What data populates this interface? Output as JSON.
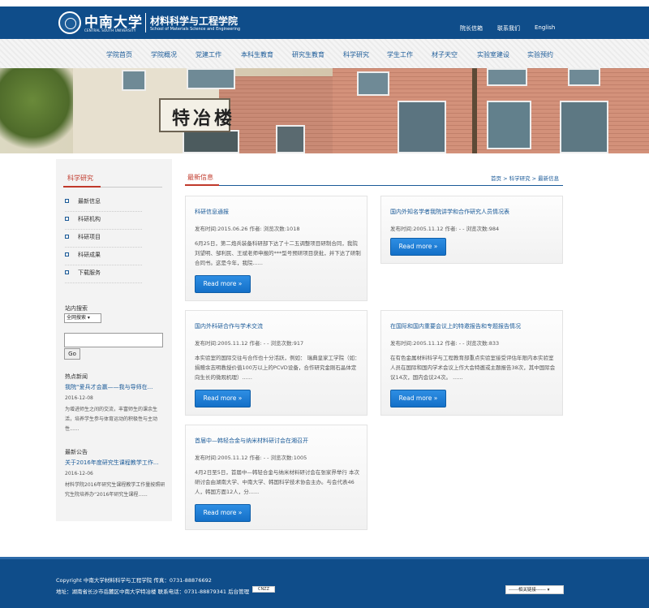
{
  "header": {
    "logo_cn": "中南大学",
    "logo_en": "CENTRAL SOUTH UNIVERSITY",
    "college_cn": "材料科学与工程学院",
    "college_en": "School of Materials Science and Engineering",
    "links": [
      "院长信箱",
      "联系我们",
      "English"
    ]
  },
  "nav": [
    "学院首页",
    "学院概况",
    "党建工作",
    "本科生教育",
    "研究生教育",
    "科学研究",
    "学生工作",
    "材子天空",
    "实验室建设",
    "实验预约"
  ],
  "banner": {
    "sign_text": "特冶楼"
  },
  "sidebar": {
    "title": "科学研究",
    "items": [
      "最新信息",
      "科研机构",
      "科研项目",
      "科研成果",
      "下载服务"
    ],
    "search_label": "站内搜索",
    "search_scope": "全网搜索",
    "go_label": "Go",
    "hot_title": "热点新闻",
    "hot_link": "我院“爱兵才会赢——我与导师在...",
    "hot_date": "2016-12-08",
    "hot_desc": "为增进师生之间的交流，丰富师生的课余生活，培养学生参与体育运动的积极性与主动性......",
    "notice_title": "最新公告",
    "notice_link": "关于2016年度研究生课程教学工作...",
    "notice_date": "2016-12-06",
    "notice_desc": "材料学院2016年研究生课程教学工作量按照研究生院培养办“2016年研究生课程......"
  },
  "main": {
    "title": "最新信息",
    "breadcrumb": "首页 > 科学研究 > 最新信息",
    "more_label": "Read more »",
    "cards": [
      {
        "title": "科研信息通报",
        "meta": "发布时间:2015.06.26     作者:        浏览次数:1018",
        "desc": "6月25日，第二炮兵装备科研部下达了十二五调整项目研制合同，我院刘望明、邹利民、王斌老师申报的***型号预研项目获批，并下达了研制合同书。这是今年，我院......"
      },
      {
        "title": "国内外知名学者我院讲学和合作研究人员情况表",
        "meta": "发布时间:2005.11.12     作者:   - -       浏览次数:984",
        "desc": ""
      },
      {
        "title": "国内外科研合作与学术交流",
        "meta": "发布时间:2005.11.12     作者:   - -       浏览次数:917",
        "desc": "本实验室的国际交往与合作也十分活跃，例如：  瑞典皇家工学院（如：捐赠余志明教授价值100万以上的PCVD设备，合作研究金刚石晶体定向生长的微观机理）......"
      },
      {
        "title": "在国际和国内重要会议上的特邀报告和专题报告情况",
        "meta": "发布时间:2005.11.12     作者:   - -       浏览次数:833",
        "desc": "在有色金属材料科学与工程教育部重点实验室接受评估年限内本实验室人员在国际和国内学术会议上作大会特邀或主题报告38次，其中国际会议14次，国内会议24次。  ......"
      },
      {
        "title": "首届中—韩轻合金与纳米材料研讨会在湘召开",
        "meta": "发布时间:2005.11.12     作者:   - -       浏览次数:1005",
        "desc": "4月2日至5日，首届中—韩轻合金与纳米材料研讨会在张家界举行 本次研讨会由湖南大学、中南大学、韩国科学技术协会主办。与会代表46人，韩国方面12人，分......"
      }
    ]
  },
  "footer": {
    "line1": "Copyright 中南大学材料科学与工程学院 传真：0731-88876692",
    "line2": "地址：湖南省长沙市岳麓区中南大学特冶楼 联系电话：0731-88879341 后台管理",
    "cnzz": "CNZZ",
    "links_select": "------相关链接------"
  },
  "colors": {
    "brand_blue": "#0f4d8a",
    "accent_red": "#c0392b",
    "button_blue": "#1f7fd6"
  }
}
